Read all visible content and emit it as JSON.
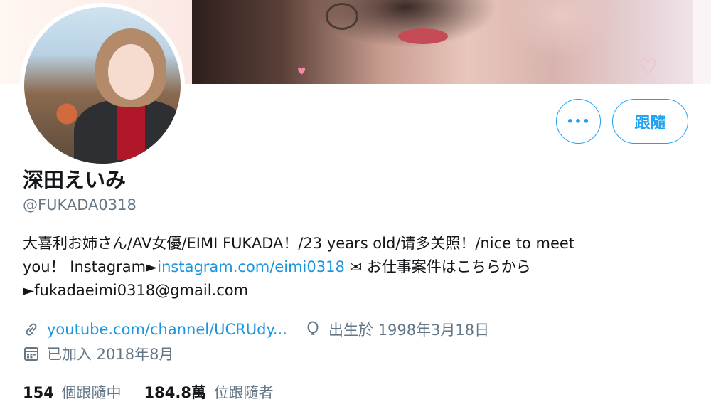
{
  "profile": {
    "display_name": "深田えいみ",
    "handle": "@FUKADA0318",
    "bio": {
      "line1": "大喜利お姉さん/AV女優/EIMI FUKADA！/23 years old/请多关照！/nice to meet",
      "line2_prefix": "you！ Instagram►",
      "instagram_link": "instagram.com/eimi0318",
      "line2_suffix": " ✉ お仕事案件はこちらから",
      "line3": "►fukadaeimi0318@gmail.com"
    },
    "website": "youtube.com/channel/UCRUdy...",
    "birthday": "出生於 1998年3月18日",
    "joined": "已加入 2018年8月"
  },
  "buttons": {
    "more_label": "•••",
    "follow_label": "跟隨"
  },
  "stats": {
    "following_count": "154",
    "following_label": "個跟隨中",
    "followers_count": "184.8萬",
    "followers_label": "位跟隨者"
  },
  "icons": {
    "link": "link-icon",
    "birthday": "balloon-icon",
    "joined": "calendar-icon"
  },
  "colors": {
    "accent": "#1da1f2",
    "link": "#1b95e0",
    "secondary_text": "#657786",
    "primary_text": "#14171a"
  }
}
